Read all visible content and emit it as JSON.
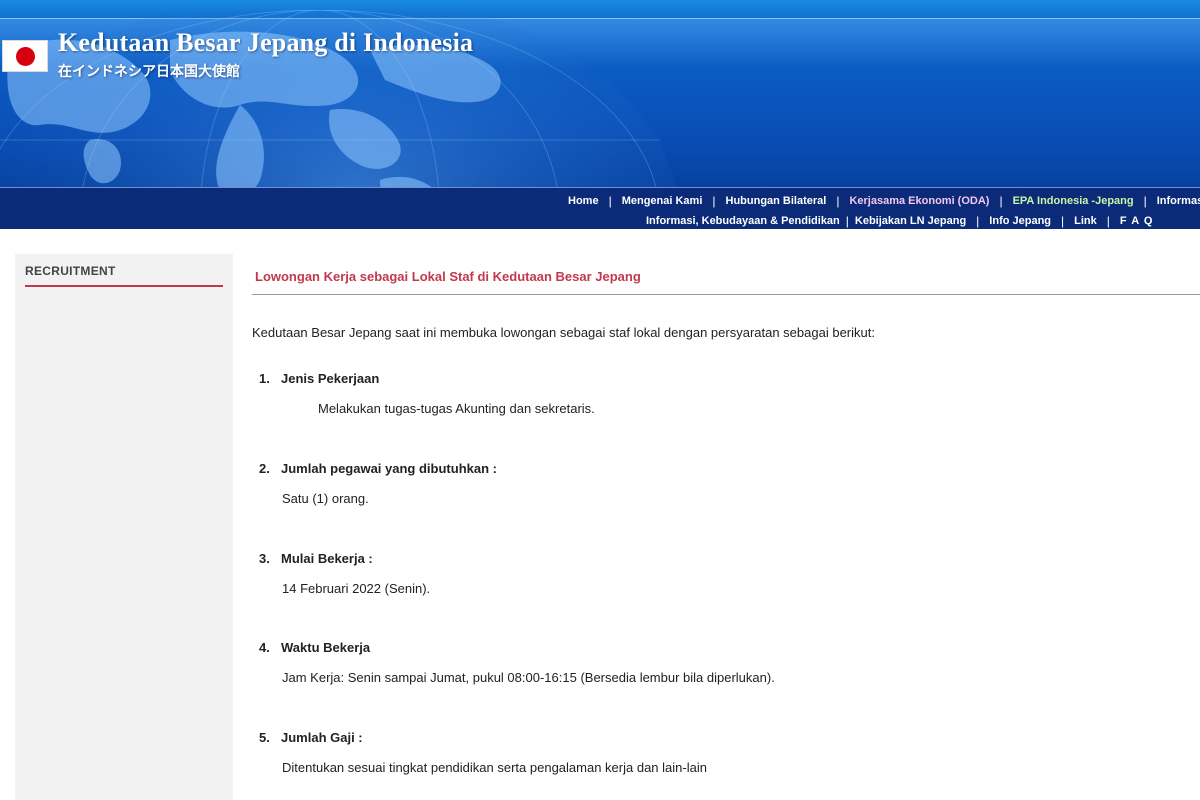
{
  "header": {
    "title": "Kedutaan Besar Jepang di Indonesia",
    "subtitle": "在インドネシア日本国大使館"
  },
  "nav": {
    "row1": [
      {
        "label": "Home"
      },
      {
        "label": "Mengenai Kami"
      },
      {
        "label": "Hubungan Bilateral"
      },
      {
        "label": "Kerjasama Ekonomi (ODA)"
      },
      {
        "label": "EPA Indonesia -Jepang"
      },
      {
        "label": "Informasi Vi"
      }
    ],
    "row2": [
      {
        "label": "Informasi, Kebudayaan & Pendidikan"
      },
      {
        "label": "Kebijakan LN Jepang"
      },
      {
        "label": "Info Jepang"
      },
      {
        "label": "Link"
      },
      {
        "label": "F A Q"
      }
    ],
    "separator": "|"
  },
  "sidebar": {
    "heading": "RECRUITMENT"
  },
  "main": {
    "title": "Lowongan Kerja sebagai Lokal Staf di Kedutaan Besar Jepang",
    "intro": "Kedutaan Besar Jepang saat ini membuka lowongan sebagai staf lokal dengan persyaratan sebagai berikut:",
    "items": [
      {
        "num": "1.",
        "heading": "Jenis Pekerjaan",
        "body": "Melakukan tugas-tugas Akunting dan sekretaris."
      },
      {
        "num": "2.",
        "heading": "Jumlah pegawai yang dibutuhkan :",
        "body": "Satu (1) orang."
      },
      {
        "num": "3.",
        "heading": "Mulai Bekerja :",
        "body": "14 Februari 2022 (Senin)."
      },
      {
        "num": "4.",
        "heading": "Waktu Bekerja",
        "body": "Jam Kerja: Senin sampai Jumat, pukul 08:00-16:15 (Bersedia lembur bila diperlukan)."
      },
      {
        "num": "5.",
        "heading": "Jumlah Gaji :",
        "body": "Ditentukan sesuai tingkat pendidikan serta pengalaman kerja dan lain-lain"
      }
    ]
  },
  "colors": {
    "banner_blue": "#0b5cc4",
    "navbar_navy": "#0b2a78",
    "accent_red": "#c2384f",
    "oda_link": "#f3c7f0",
    "epa_link": "#c8f5a8",
    "sidebar_bg": "#f2f2f2"
  }
}
